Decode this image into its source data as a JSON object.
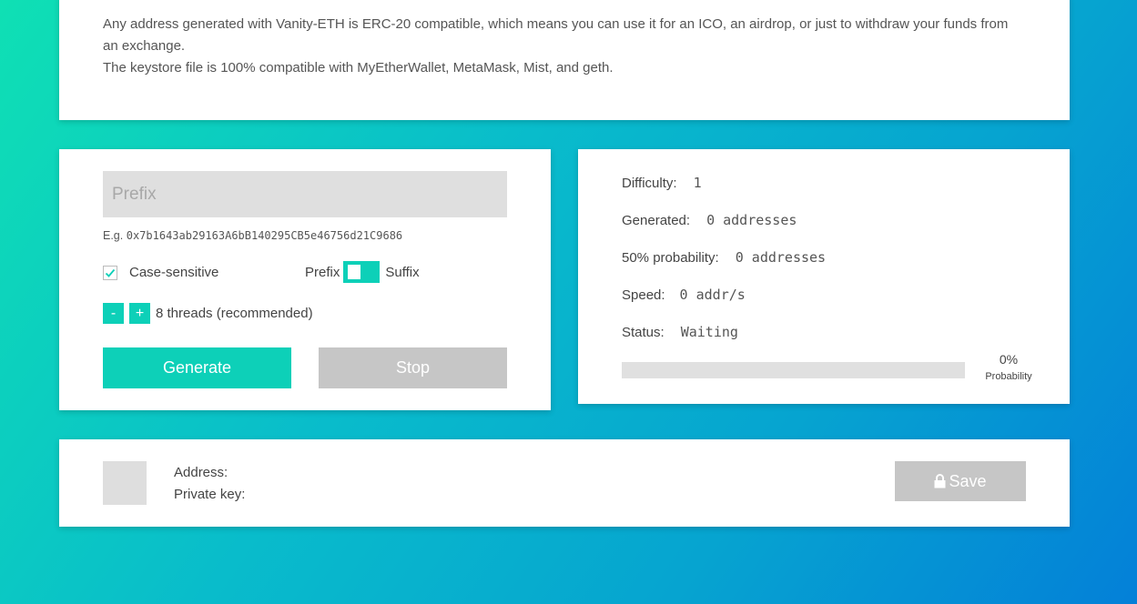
{
  "intro": {
    "line1": "Any address generated with Vanity-ETH is ERC-20 compatible, which means you can use it for an ICO, an airdrop, or just to withdraw your funds from an exchange.",
    "line2": "The keystore file is 100% compatible with MyEtherWallet, MetaMask, Mist, and geth."
  },
  "input": {
    "placeholder": "Prefix",
    "example_prefix": "E.g. ",
    "example_address": "0x7b1643ab29163A6bB140295CB5e46756d21C9686",
    "case_sensitive_label": "Case-sensitive",
    "case_sensitive_checked": true,
    "toggle_left_label": "Prefix",
    "toggle_right_label": "Suffix",
    "minus_label": "-",
    "plus_label": "+",
    "threads_label": "8 threads (recommended)",
    "generate_label": "Generate",
    "stop_label": "Stop"
  },
  "stats": {
    "difficulty_label": "Difficulty:",
    "difficulty_value": "1",
    "generated_label": "Generated:",
    "generated_value": "0 addresses",
    "probability50_label": "50% probability:",
    "probability50_value": "0 addresses",
    "speed_label": "Speed:",
    "speed_value": "0 addr/s",
    "status_label": "Status:",
    "status_value": "Waiting",
    "progress_percent": "0%",
    "progress_value": 0,
    "progress_caption": "Probability"
  },
  "result": {
    "address_label": "Address:",
    "private_key_label": "Private key:",
    "save_label": "Save"
  },
  "colors": {
    "accent": "#0dd0b8",
    "disabled": "#c6c6c6"
  }
}
